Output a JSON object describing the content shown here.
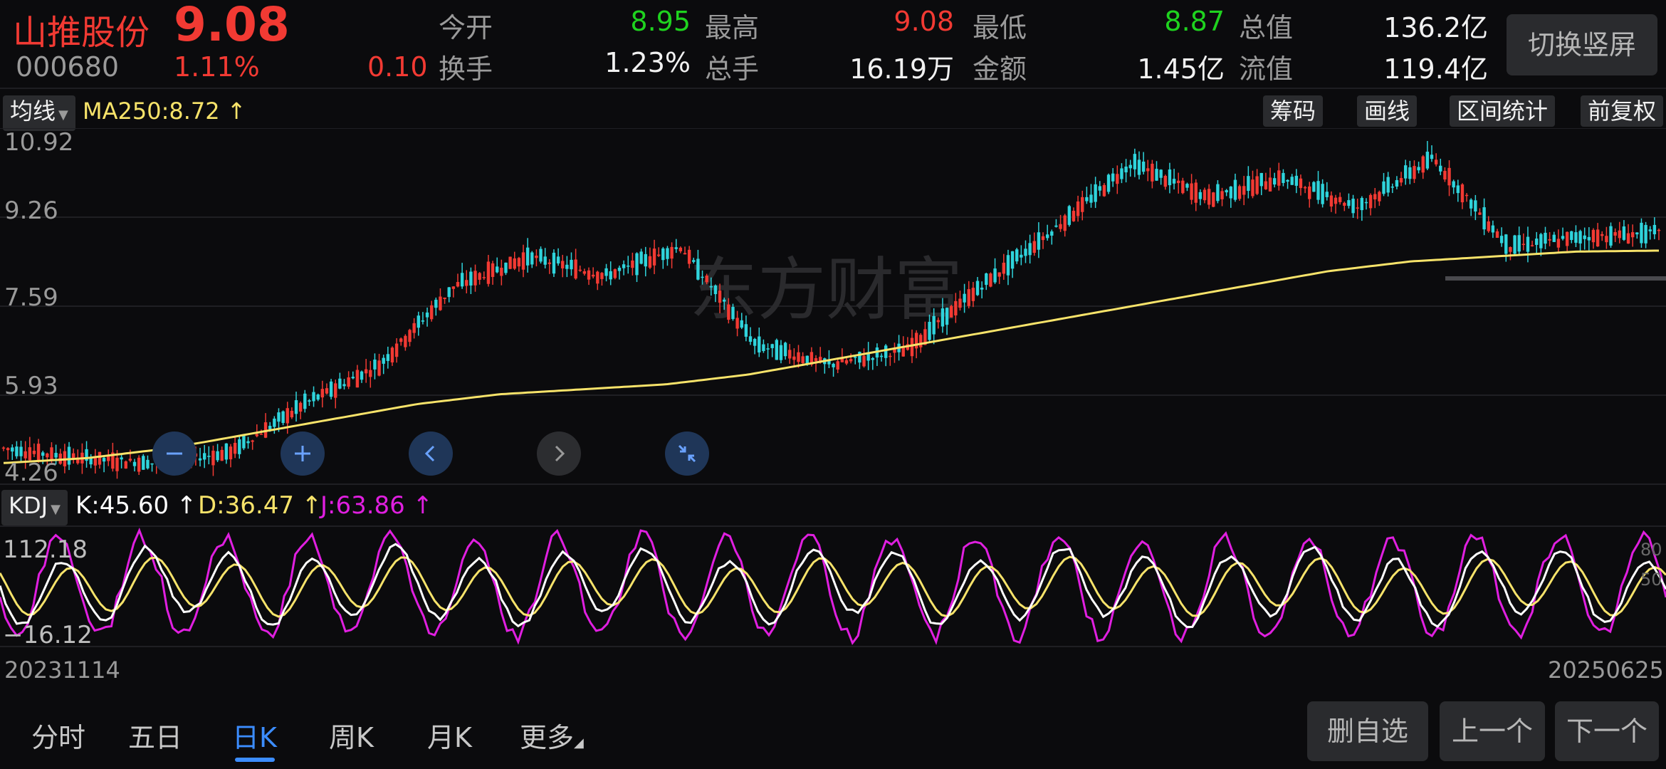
{
  "header": {
    "stock_name": "山推股份",
    "price": "9.08",
    "code": "000680",
    "change_pct": "1.11%",
    "change": "0.10",
    "quotes": [
      {
        "label": "今开",
        "value": "8.95",
        "color": "green"
      },
      {
        "label": "最高",
        "value": "9.08",
        "color": "red"
      },
      {
        "label": "最低",
        "value": "8.87",
        "color": "green"
      },
      {
        "label": "总值",
        "value": "136.2亿",
        "color": "white"
      },
      {
        "label": "换手",
        "value": "1.23%",
        "color": "white"
      },
      {
        "label": "总手",
        "value": "16.19万",
        "color": "white"
      },
      {
        "label": "金额",
        "value": "1.45亿",
        "color": "white"
      },
      {
        "label": "流值",
        "value": "119.4亿",
        "color": "white"
      }
    ],
    "switch_label": "切换竖屏"
  },
  "toolbar": {
    "ma_dropdown": "均线",
    "ma_text": "MA250:8.72",
    "buttons": [
      "筹码",
      "画线",
      "区间统计",
      "前复权"
    ]
  },
  "main_chart": {
    "y_ticks": [
      "10.92",
      "9.26",
      "7.59",
      "5.93",
      "4.26"
    ],
    "watermark": "东方财富"
  },
  "kdj": {
    "dropdown": "KDJ",
    "k": "K:45.60",
    "d": "D:36.47",
    "j": "J:63.86",
    "y_top": "112.18",
    "y_bottom": "−16.12",
    "right_ticks": [
      "80",
      "50"
    ]
  },
  "dates": {
    "start": "20231114",
    "end": "20250625"
  },
  "tabs": [
    "分时",
    "五日",
    "日K",
    "周K",
    "月K",
    "更多"
  ],
  "active_tab": "日K",
  "bottom_buttons": [
    "删自选",
    "上一个",
    "下一个"
  ],
  "colors": {
    "up": "#f23a33",
    "down": "#2fd4dc",
    "ma": "#f7e36a",
    "k": "#ffffff",
    "d": "#f7e36a",
    "j": "#e01fe0",
    "accent": "#3c8dff"
  },
  "chart_data": {
    "type": "line",
    "title": "",
    "x": [
      "20231114",
      "20250625"
    ],
    "ylim": [
      4.26,
      10.92
    ],
    "series": [
      {
        "name": "MA250",
        "values": [
          4.4,
          4.5,
          4.7,
          5.0,
          5.3,
          5.6,
          5.8,
          5.9,
          6.0,
          6.2,
          6.5,
          6.8,
          7.1,
          7.4,
          7.7,
          8.0,
          8.3,
          8.5,
          8.6,
          8.7,
          8.72
        ]
      },
      {
        "name": "Close",
        "values": [
          4.7,
          4.5,
          4.4,
          4.6,
          5.6,
          6.4,
          8.0,
          8.6,
          8.2,
          8.8,
          6.8,
          6.4,
          6.7,
          8.0,
          9.2,
          10.5,
          9.8,
          10.2,
          9.6,
          10.6,
          8.8,
          9.0,
          9.08
        ]
      }
    ]
  }
}
